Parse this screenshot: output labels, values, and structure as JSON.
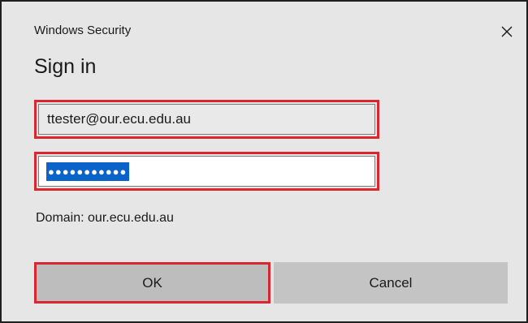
{
  "window": {
    "title": "Windows Security",
    "close_icon": "close-icon"
  },
  "heading": "Sign in",
  "username_field": {
    "value": "ttester@our.ecu.edu.au"
  },
  "password_field": {
    "masked_value": "●●●●●●●●●●●",
    "selected": true
  },
  "domain_text": "Domain: our.ecu.edu.au",
  "buttons": {
    "ok_label": "OK",
    "cancel_label": "Cancel"
  },
  "colors": {
    "highlight_border": "#d9262f",
    "selection": "#0a63c9",
    "dialog_background": "#e6e6e6"
  }
}
